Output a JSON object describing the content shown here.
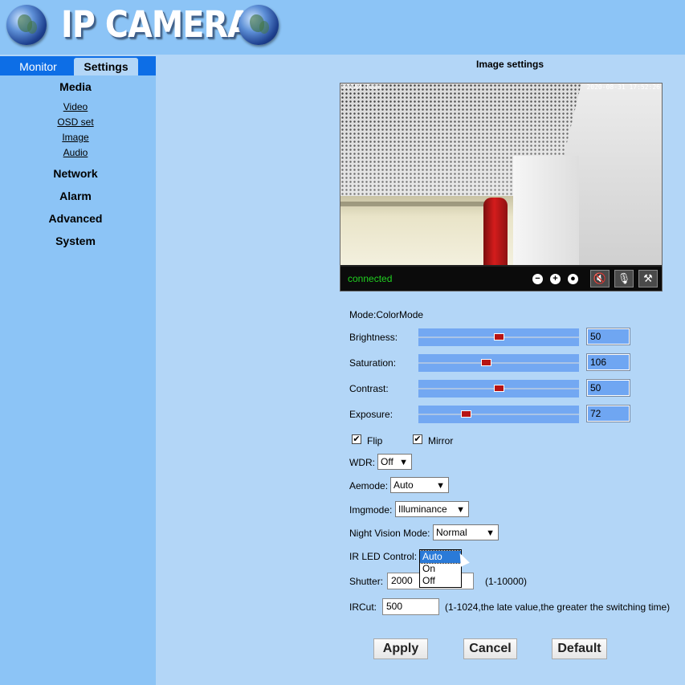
{
  "header": {
    "title": "IP CAMERA"
  },
  "tabs": {
    "monitor": "Monitor",
    "settings": "Settings"
  },
  "nav": {
    "media": "Media",
    "media_items": [
      "Video",
      "OSD set",
      "Image",
      "Audio"
    ],
    "network": "Network",
    "alarm": "Alarm",
    "advanced": "Advanced",
    "system": "System"
  },
  "page": {
    "title": "Image settings"
  },
  "video": {
    "osd_label": "HOCAM Team",
    "timestamp": "2020-08-31 17:52:26",
    "status": "connected",
    "controls": {
      "zoom_out": "−",
      "zoom_in": "+",
      "record": "●",
      "mute": "🔇",
      "mic": "🎙",
      "settings": "⚒"
    }
  },
  "form": {
    "mode": "Mode:ColorMode",
    "brightness_label": "Brightness:",
    "brightness": 50,
    "brightness_value": "50",
    "saturation_label": "Saturation:",
    "saturation": 106,
    "saturation_value": "106",
    "contrast_label": "Contrast:",
    "contrast": 50,
    "contrast_value": "50",
    "exposure_label": "Exposure:",
    "exposure": 72,
    "exposure_value": "72",
    "flip_label": "Flip",
    "flip_checked": "✔",
    "mirror_label": "Mirror",
    "mirror_checked": "✔",
    "wdr_label": "WDR:",
    "wdr_value": "Off",
    "aemode_label": "Aemode:",
    "aemode_value": "Auto",
    "imgmode_label": "Imgmode:",
    "imgmode_value": "Illuminance",
    "night_label": "Night Vision Mode:",
    "night_value": "Normal",
    "irled_label": "IR LED Control:",
    "irled_options": [
      "Auto",
      "On",
      "Off"
    ],
    "shutter_label": "Shutter:",
    "shutter_value": "2000",
    "shutter_hint": "(1-10000)",
    "ircut_label": "IRCut:",
    "ircut_value": "500",
    "ircut_hint": "(1-1024,the late value,the greater the switching time)"
  },
  "buttons": {
    "apply": "Apply",
    "cancel": "Cancel",
    "default": "Default"
  },
  "colors": {
    "sidebar": "#8cc4f6",
    "main": "#b3d6f7",
    "tabbar": "#0d6ee6",
    "slider": "#73a8f2",
    "knob": "#b71414"
  }
}
